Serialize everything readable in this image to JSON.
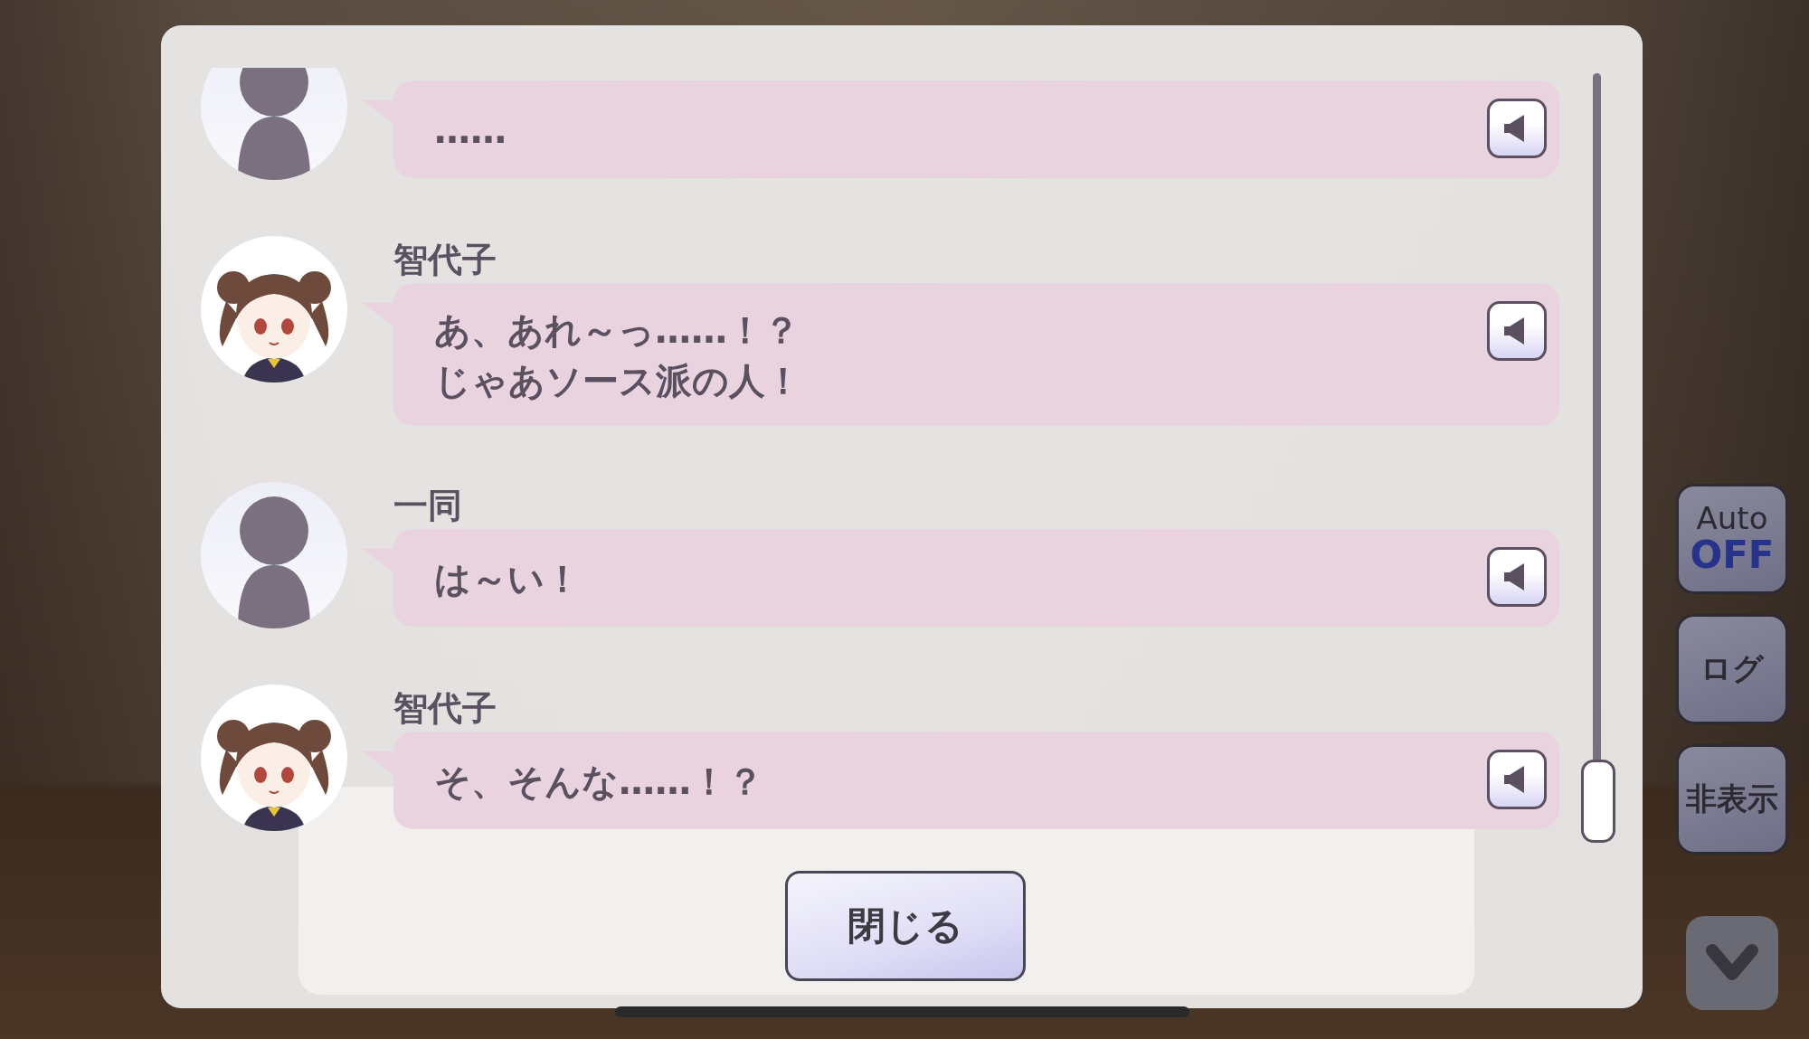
{
  "side_buttons": [
    {
      "kind": "toggle",
      "label": "Auto",
      "state": "OFF"
    },
    {
      "kind": "text",
      "label": "ログ"
    },
    {
      "kind": "text",
      "label": "非表示"
    },
    {
      "kind": "chevron"
    }
  ],
  "log": {
    "entries": [
      {
        "kind": "silhouette",
        "lines": [
          "……"
        ]
      },
      {
        "speaker": "智代子",
        "kind": "character",
        "lines": [
          "あ、あれ～っ……！？",
          "じゃあソース派の人！"
        ]
      },
      {
        "speaker": "一同",
        "kind": "silhouette",
        "lines": [
          "は～い！"
        ]
      },
      {
        "speaker": "智代子",
        "kind": "character",
        "lines": [
          "そ、そんな……！？"
        ]
      }
    ],
    "close_button": "閉じる"
  }
}
